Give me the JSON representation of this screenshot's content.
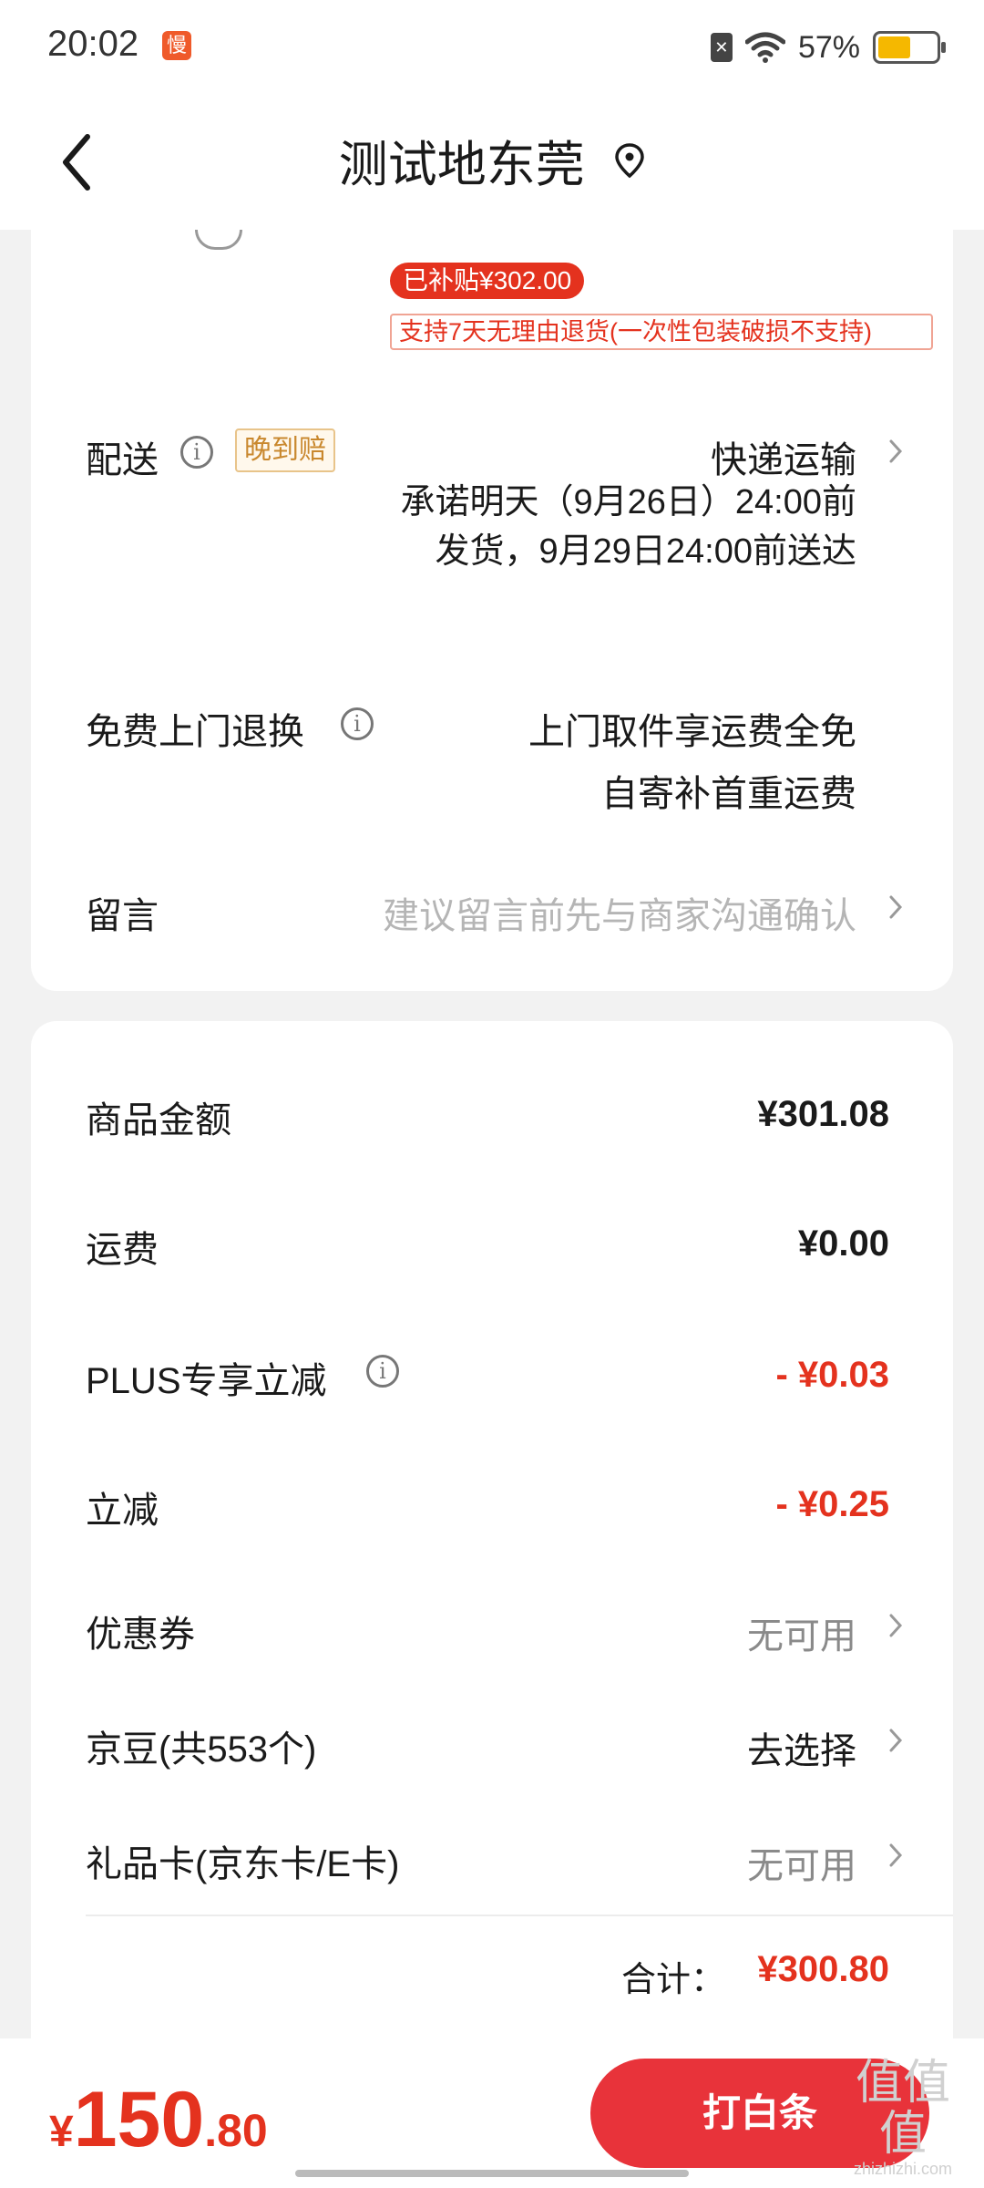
{
  "status_bar": {
    "time": "20:02",
    "app_badge": "慢",
    "sim": "✕",
    "battery_text": "57%",
    "battery_level": 0.57,
    "battery_color": "#f5b800"
  },
  "header": {
    "title": "测试地东莞"
  },
  "product": {
    "subsidy_tag": "已补贴¥302.00",
    "return_policy": "支持7天无理由退货(一次性包装破损不支持)"
  },
  "delivery": {
    "label": "配送",
    "late_badge": "晚到赔",
    "method": "快递运输",
    "desc": "承诺明天（9月26日）24:00前发货，9月29日24:00前送达"
  },
  "free_return": {
    "label": "免费上门退换",
    "line1": "上门取件享运费全免",
    "line2": "自寄补首重运费"
  },
  "message": {
    "label": "留言",
    "placeholder": "建议留言前先与商家沟通确认"
  },
  "summary": {
    "goods_label": "商品金额",
    "goods_value": "¥301.08",
    "shipping_label": "运费",
    "shipping_value": "¥0.00",
    "plus_label": "PLUS专享立减",
    "plus_value": "- ¥0.03",
    "discount_label": "立减",
    "discount_value": "- ¥0.25",
    "coupon_label": "优惠券",
    "coupon_value": "无可用",
    "jd_bean_label": "京豆(共553个)",
    "jd_bean_value": "去选择",
    "gift_card_label": "礼品卡(京东卡/E卡)",
    "gift_card_value": "无可用",
    "total_label": "合计：",
    "total_value": "¥300.80"
  },
  "bottom": {
    "currency": "¥",
    "amount_int": "150",
    "amount_dec": ".80",
    "pay_button": "打白条"
  },
  "watermark": {
    "logo": "值值值",
    "url": "zhizhizhi.com"
  },
  "colors": {
    "accent_red": "#e4321e",
    "button_red": "#e8333a",
    "badge_gold": "#c9882e"
  }
}
